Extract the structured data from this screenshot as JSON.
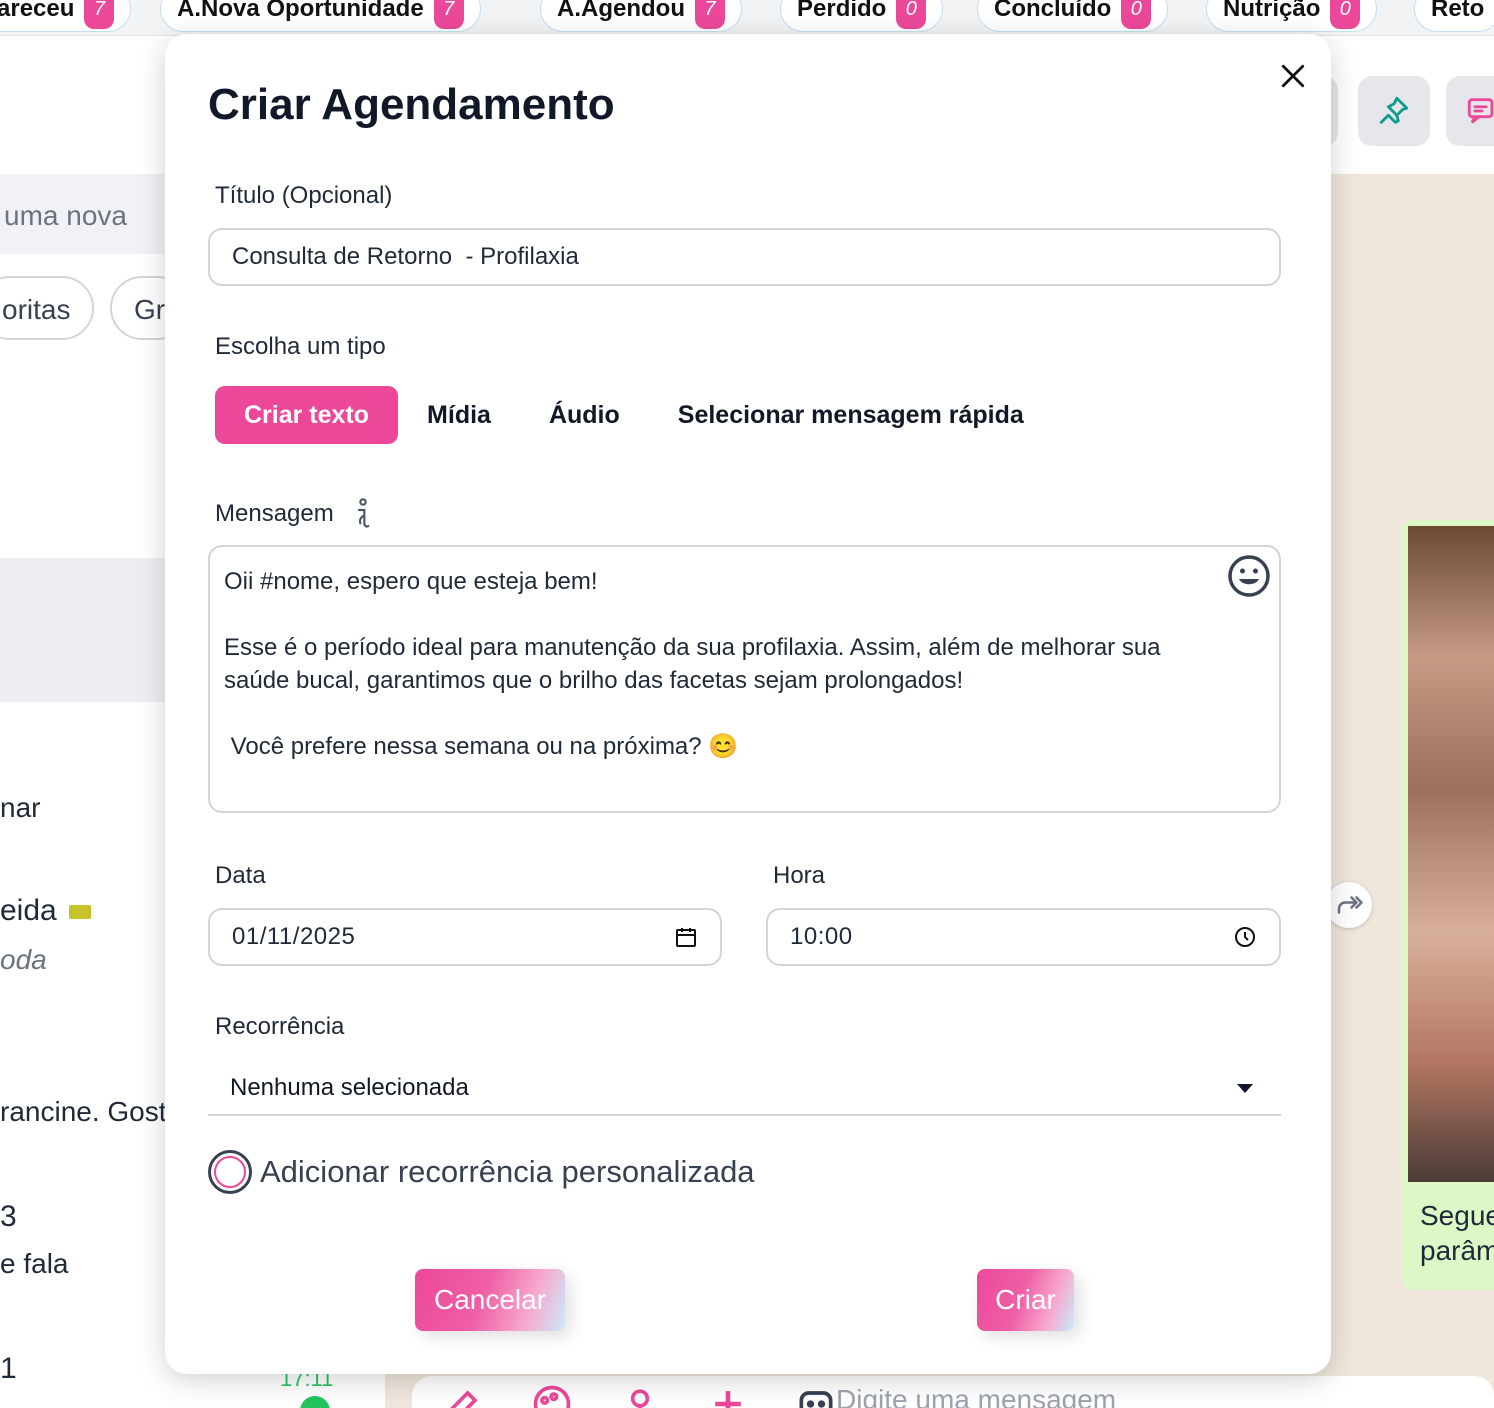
{
  "colors": {
    "accent": "#ec4899",
    "bubble": "#dcf8c6",
    "online": "#22c55e",
    "chat_bg": "#efe7dc"
  },
  "background": {
    "funnel_tabs": [
      {
        "label": "areceu",
        "count": "7"
      },
      {
        "label": "A.Nova Oportunidade",
        "count": "7"
      },
      {
        "label": "A.Agendou",
        "count": "7"
      },
      {
        "label": "Perdido",
        "count": "0"
      },
      {
        "label": "Concluído",
        "count": "0"
      },
      {
        "label": "Nutrição",
        "count": "0"
      },
      {
        "label": "Reto",
        "count": ""
      }
    ],
    "left": {
      "search_fragment": "uma nova",
      "chips": [
        "oritas",
        "Gr"
      ],
      "items": [
        "nar",
        "eida",
        "oda",
        "rancine. Gost",
        "3",
        "e fala",
        "1"
      ],
      "time": "17:11"
    },
    "chat": {
      "caption_line1": "Segue",
      "caption_line2": "parâm",
      "compose_placeholder": "Digite uma mensagem"
    }
  },
  "modal": {
    "title": "Criar Agendamento",
    "title_label": "Título (Opcional)",
    "title_value": "Consulta de Retorno  - Profilaxia",
    "type_label": "Escolha um tipo",
    "types": [
      "Criar texto",
      "Mídia",
      "Áudio",
      "Selecionar mensagem rápida"
    ],
    "active_type": "Criar texto",
    "message_label": "Mensagem",
    "message_lines": [
      "Oii #nome, espero que esteja bem!",
      "",
      "Esse é o período ideal para manutenção da sua profilaxia. Assim, além de melhorar sua",
      "saúde bucal, garantimos que o brilho das facetas sejam prolongados!",
      "",
      " Você prefere nessa semana ou na próxima? 😊"
    ],
    "date_label": "Data",
    "date_value": "01/11/2025",
    "time_label": "Hora",
    "time_value": "10:00",
    "recurrence_label": "Recorrência",
    "recurrence_value": "Nenhuma selecionada",
    "custom_recurrence_label": "Adicionar recorrência personalizada",
    "cancel_label": "Cancelar",
    "create_label": "Criar"
  }
}
